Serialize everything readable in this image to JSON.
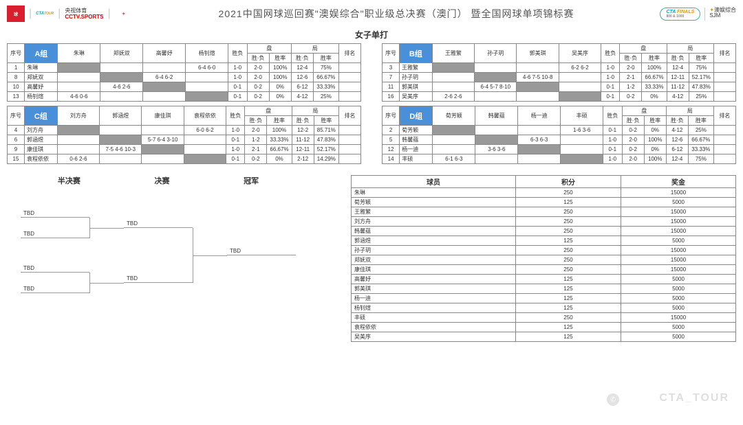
{
  "title": "2021中国网球巡回赛\"澳娱综合\"职业级总决赛（澳门） 暨全国网球单项锦标赛",
  "subtitle": "女子单打",
  "logos": {
    "cctvCn": "央视体育",
    "cctvEn": "CCTV.SPORTS",
    "ctaFin1": "CTA",
    "ctaFin2": "FINALS",
    "ctaFin3": "800 & 1000",
    "sjm1": "澳娱综合",
    "sjm2": "SJM"
  },
  "hdrs": {
    "seq": "序号",
    "wl": "胜负",
    "set": "盘",
    "game": "局",
    "rank": "排名",
    "sf": "胜·负",
    "rate": "胜率"
  },
  "groups": [
    {
      "name": "A组",
      "players": [
        "朱琳",
        "郑妩双",
        "高馨妤",
        "杨钊煊"
      ],
      "rows": [
        {
          "n": 1,
          "p": "朱琳",
          "s": [
            "",
            "",
            "",
            "6-4 6-0"
          ],
          "wl": "1-0",
          "sf1": "2-0",
          "r1": "100%",
          "sf2": "12-4",
          "r2": "75%"
        },
        {
          "n": 8,
          "p": "郑妩双",
          "s": [
            "",
            "",
            "6-4 6-2",
            ""
          ],
          "wl": "1-0",
          "sf1": "2-0",
          "r1": "100%",
          "sf2": "12-6",
          "r2": "66.67%"
        },
        {
          "n": 10,
          "p": "高馨妤",
          "s": [
            "",
            "4-6 2-6",
            "",
            ""
          ],
          "wl": "0-1",
          "sf1": "0-2",
          "r1": "0%",
          "sf2": "6-12",
          "r2": "33.33%"
        },
        {
          "n": 13,
          "p": "杨钊煊",
          "s": [
            "4-6 0-6",
            "",
            "",
            ""
          ],
          "wl": "0-1",
          "sf1": "0-2",
          "r1": "0%",
          "sf2": "4-12",
          "r2": "25%"
        }
      ]
    },
    {
      "name": "B组",
      "players": [
        "王雅繁",
        "孙子玥",
        "郭美琪",
        "吴美序"
      ],
      "rows": [
        {
          "n": 3,
          "p": "王雅繁",
          "s": [
            "",
            "",
            "",
            "6-2 6-2"
          ],
          "wl": "1-0",
          "sf1": "2-0",
          "r1": "100%",
          "sf2": "12-4",
          "r2": "75%"
        },
        {
          "n": 7,
          "p": "孙子玥",
          "s": [
            "",
            "",
            "4-6 7-5 10-8",
            ""
          ],
          "wl": "1-0",
          "sf1": "2-1",
          "r1": "66.67%",
          "sf2": "12-11",
          "r2": "52.17%"
        },
        {
          "n": 11,
          "p": "郭美琪",
          "s": [
            "",
            "6-4 5-7 8-10",
            "",
            ""
          ],
          "wl": "0-1",
          "sf1": "1-2",
          "r1": "33.33%",
          "sf2": "11-12",
          "r2": "47.83%"
        },
        {
          "n": 16,
          "p": "吴美序",
          "s": [
            "2-6 2-6",
            "",
            "",
            ""
          ],
          "wl": "0-1",
          "sf1": "0-2",
          "r1": "0%",
          "sf2": "4-12",
          "r2": "25%"
        }
      ]
    },
    {
      "name": "C组",
      "players": [
        "刘方舟",
        "郭涵煜",
        "康佳琪",
        "袁程依依"
      ],
      "rows": [
        {
          "n": 4,
          "p": "刘方舟",
          "s": [
            "",
            "",
            "",
            "6-0 6-2"
          ],
          "wl": "1-0",
          "sf1": "2-0",
          "r1": "100%",
          "sf2": "12-2",
          "r2": "85.71%"
        },
        {
          "n": 6,
          "p": "郭涵煜",
          "s": [
            "",
            "",
            "5-7 6-4  3-10",
            ""
          ],
          "wl": "0-1",
          "sf1": "1-2",
          "r1": "33.33%",
          "sf2": "11-12",
          "r2": "47.83%"
        },
        {
          "n": 9,
          "p": "康佳琪",
          "s": [
            "",
            "7-5 4-6  10-3",
            "",
            ""
          ],
          "wl": "1-0",
          "sf1": "2-1",
          "r1": "66.67%",
          "sf2": "12-11",
          "r2": "52.17%"
        },
        {
          "n": 15,
          "p": "袁程依依",
          "s": [
            "0-6 2-6",
            "",
            "",
            ""
          ],
          "wl": "0-1",
          "sf1": "0-2",
          "r1": "0%",
          "sf2": "2-12",
          "r2": "14.29%"
        }
      ]
    },
    {
      "name": "D组",
      "players": [
        "荀芳颖",
        "韩馨蕴",
        "杨一迪",
        "丰硕"
      ],
      "rows": [
        {
          "n": 2,
          "p": "荀芳颖",
          "s": [
            "",
            "",
            "",
            "1-6 3-6"
          ],
          "wl": "0-1",
          "sf1": "0-2",
          "r1": "0%",
          "sf2": "4-12",
          "r2": "25%"
        },
        {
          "n": 5,
          "p": "韩馨蕴",
          "s": [
            "",
            "",
            "6-3 6-3",
            ""
          ],
          "wl": "1-0",
          "sf1": "2-0",
          "r1": "100%",
          "sf2": "12-6",
          "r2": "66.67%"
        },
        {
          "n": 12,
          "p": "杨一迪",
          "s": [
            "",
            "3-6 3-6",
            "",
            ""
          ],
          "wl": "0-1",
          "sf1": "0-2",
          "r1": "0%",
          "sf2": "6-12",
          "r2": "33.33%"
        },
        {
          "n": 14,
          "p": "丰硕",
          "s": [
            "6-1 6-3",
            "",
            "",
            ""
          ],
          "wl": "1-0",
          "sf1": "2-0",
          "r1": "100%",
          "sf2": "12-4",
          "r2": "75%"
        }
      ]
    }
  ],
  "bracket": {
    "sf": "半决赛",
    "f": "决赛",
    "c": "冠军",
    "tbd": "TBD"
  },
  "prize": {
    "h1": "球员",
    "h2": "积分",
    "h3": "奖金",
    "rows": [
      {
        "p": "朱琳",
        "pt": 250,
        "m": 15000
      },
      {
        "p": "荀芳颖",
        "pt": 125,
        "m": 5000
      },
      {
        "p": "王雅繁",
        "pt": 250,
        "m": 15000
      },
      {
        "p": "刘方舟",
        "pt": 250,
        "m": 15000
      },
      {
        "p": "韩馨蕴",
        "pt": 250,
        "m": 15000
      },
      {
        "p": "郭涵煜",
        "pt": 125,
        "m": 5000
      },
      {
        "p": "孙子玥",
        "pt": 250,
        "m": 15000
      },
      {
        "p": "郑妩双",
        "pt": 250,
        "m": 15000
      },
      {
        "p": "康佳琪",
        "pt": 250,
        "m": 15000
      },
      {
        "p": "高馨妤",
        "pt": 125,
        "m": 5000
      },
      {
        "p": "郭美琪",
        "pt": 125,
        "m": 5000
      },
      {
        "p": "杨一迪",
        "pt": 125,
        "m": 5000
      },
      {
        "p": "杨钊煊",
        "pt": 125,
        "m": 5000
      },
      {
        "p": "丰硕",
        "pt": 250,
        "m": 15000
      },
      {
        "p": "袁程依依",
        "pt": 125,
        "m": 5000
      },
      {
        "p": "吴美序",
        "pt": 125,
        "m": 5000
      }
    ]
  },
  "wm": "CTA_TOUR"
}
